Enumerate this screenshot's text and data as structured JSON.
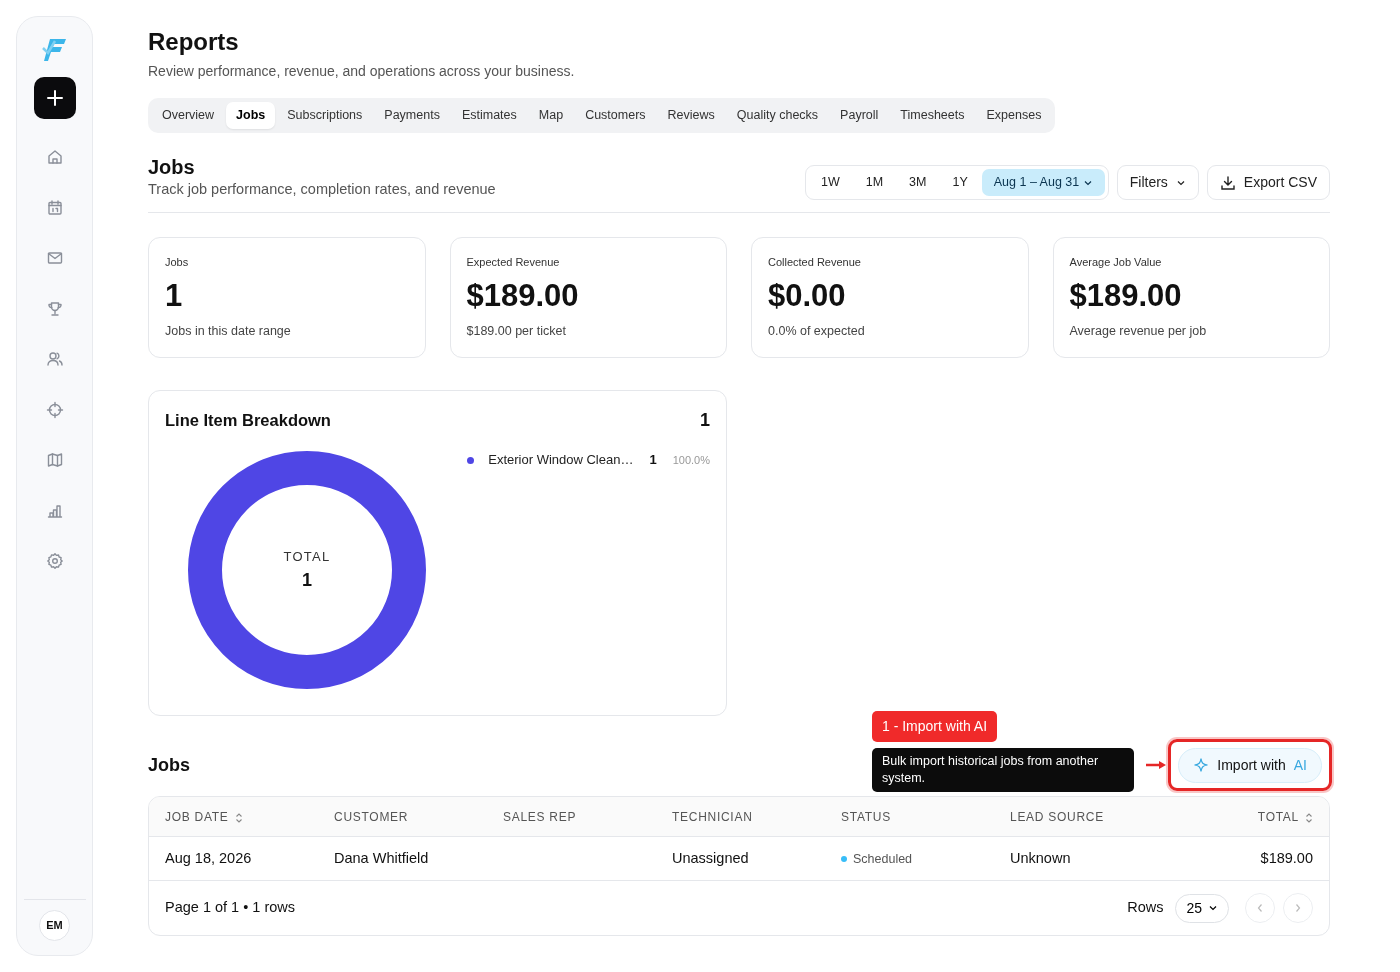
{
  "sidebar": {
    "items": [
      {
        "kind": "home",
        "selected": false
      },
      {
        "kind": "calendar",
        "selected": false
      },
      {
        "kind": "mail",
        "selected": false
      },
      {
        "kind": "trophy",
        "selected": false
      },
      {
        "kind": "users",
        "selected": false
      },
      {
        "kind": "target",
        "selected": false
      },
      {
        "kind": "map",
        "selected": false
      },
      {
        "kind": "chart",
        "selected": false
      },
      {
        "kind": "settings",
        "selected": false
      }
    ],
    "avatar": "EM"
  },
  "page": {
    "title": "Reports",
    "subtitle": "Review performance, revenue, and operations across your business."
  },
  "tabs": [
    {
      "label": "Overview",
      "selected": false
    },
    {
      "label": "Jobs",
      "selected": true
    },
    {
      "label": "Subscriptions",
      "selected": false
    },
    {
      "label": "Payments",
      "selected": false
    },
    {
      "label": "Estimates",
      "selected": false
    },
    {
      "label": "Map",
      "selected": false
    },
    {
      "label": "Customers",
      "selected": false
    },
    {
      "label": "Reviews",
      "selected": false
    },
    {
      "label": "Quality checks",
      "selected": false
    },
    {
      "label": "Payroll",
      "selected": false
    },
    {
      "label": "Timesheets",
      "selected": false
    },
    {
      "label": "Expenses",
      "selected": false
    }
  ],
  "section": {
    "title": "Jobs",
    "subtitle": "Track job performance, completion rates, and revenue"
  },
  "ranges": [
    {
      "label": "1W",
      "selected": false
    },
    {
      "label": "1M",
      "selected": false
    },
    {
      "label": "3M",
      "selected": false
    },
    {
      "label": "1Y",
      "selected": false
    },
    {
      "label": "Aug 1 – Aug 31",
      "selected": true
    }
  ],
  "filters_button": "Filters",
  "export_button": "Export CSV",
  "stats": [
    {
      "label": "Jobs",
      "value": "1",
      "note": "Jobs in this date range"
    },
    {
      "label": "Expected Revenue",
      "value": "$189.00",
      "note": "$189.00 per ticket"
    },
    {
      "label": "Collected Revenue",
      "value": "$0.00",
      "note": "0.0% of expected"
    },
    {
      "label": "Average Job Value",
      "value": "$189.00",
      "note": "Average revenue per job"
    }
  ],
  "breakdown": {
    "title": "Line Item Breakdown",
    "count": "1",
    "center_label": "TOTAL",
    "center_value": "1",
    "legend": [
      {
        "label": "Exterior Window Clean…",
        "count": "1",
        "percent": "100.0%",
        "color": "#4f46e5"
      }
    ]
  },
  "jobs_table": {
    "title": "Jobs",
    "import_button": {
      "label": "Import with",
      "accent": "AI"
    },
    "annotation": {
      "tag": "1 - Import with AI",
      "tooltip": "Bulk import historical jobs from another system."
    },
    "columns": [
      {
        "label": "JOB DATE",
        "sortable": true
      },
      {
        "label": "CUSTOMER",
        "sortable": false
      },
      {
        "label": "SALES REP",
        "sortable": false
      },
      {
        "label": "TECHNICIAN",
        "sortable": false
      },
      {
        "label": "STATUS",
        "sortable": false
      },
      {
        "label": "LEAD SOURCE",
        "sortable": false
      },
      {
        "label": "TOTAL",
        "sortable": true
      }
    ],
    "rows": [
      {
        "cells": [
          "Aug 18, 2026",
          "Dana Whitfield",
          "",
          "Unassigned",
          "Scheduled",
          "Unknown",
          "$189.00"
        ],
        "color": "#38bdf8"
      }
    ],
    "footer": "Page 1 of 1 • 1 rows",
    "rows_label": "Rows",
    "rows_per_page": "25"
  }
}
